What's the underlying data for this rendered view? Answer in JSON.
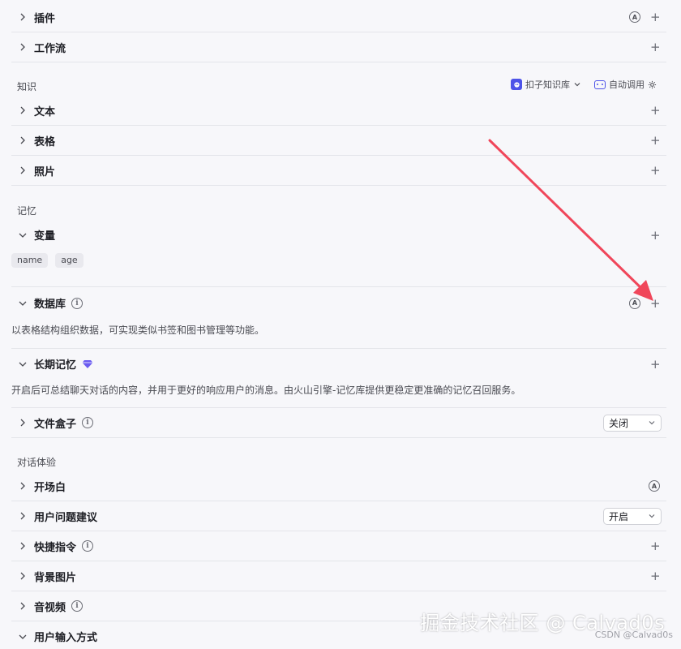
{
  "sections": {
    "knowledge": "知识",
    "memory": "记忆",
    "dialog": "对话体验"
  },
  "knowledge_bar": {
    "kb_label": "扣子知识库",
    "auto_label": "自动调用"
  },
  "rows": {
    "plugin": "插件",
    "workflow": "工作流",
    "text": "文本",
    "table": "表格",
    "photo": "照片",
    "variable": "变量",
    "database": "数据库",
    "long_memory": "长期记忆",
    "file_box": "文件盒子",
    "opening": "开场白",
    "suggestion": "用户问题建议",
    "shortcut": "快捷指令",
    "background": "背景图片",
    "av": "音视频",
    "input_mode": "用户输入方式"
  },
  "variables": [
    "name",
    "age"
  ],
  "descriptions": {
    "database": "以表格结构组织数据，可实现类似书签和图书管理等功能。",
    "long_memory": "开启后可总结聊天对话的内容，并用于更好的响应用户的消息。由火山引擎-记忆库提供更稳定更准确的记忆召回服务。"
  },
  "selects": {
    "file_box": "关闭",
    "suggestion": "开启"
  },
  "icons": {
    "plus": "+",
    "auto": "A",
    "info": "i"
  },
  "watermark": "掘金技术社区 @ Calvad0s",
  "csdn": "CSDN @Calvad0s",
  "colors": {
    "accent": "#4d53e8",
    "arrow": "#f0465a",
    "gem": "#6b5cf0"
  }
}
